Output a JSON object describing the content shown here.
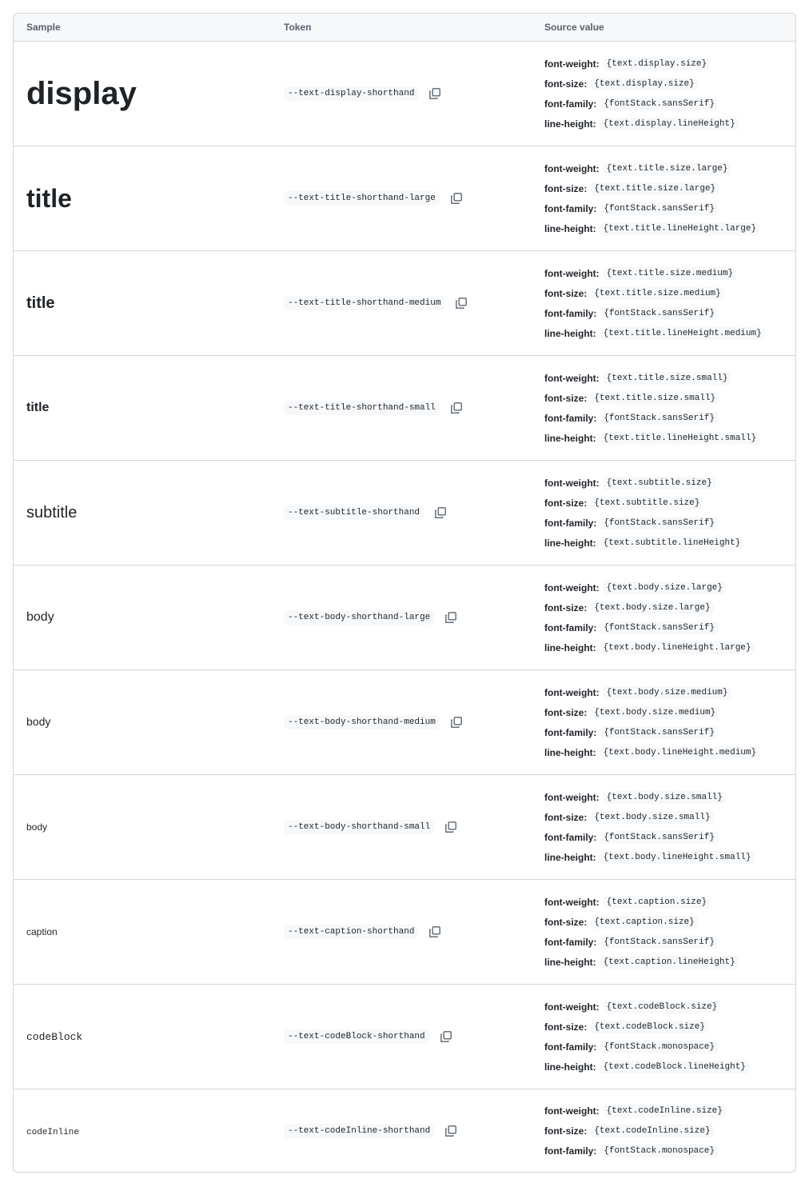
{
  "columns": {
    "sample": "Sample",
    "token": "Token",
    "source": "Source value"
  },
  "labels": {
    "weight": "font-weight:",
    "size": "font-size:",
    "family": "font-family:",
    "lineheight": "line-height:"
  },
  "rows": [
    {
      "sample": "display",
      "token": "--text-display-shorthand",
      "weight": "{text.display.size}",
      "size": "{text.display.size}",
      "family": "{fontStack.sansSerif}",
      "lineheight": "{text.display.lineHeight}"
    },
    {
      "sample": "title",
      "token": "--text-title-shorthand-large",
      "weight": "{text.title.size.large}",
      "size": "{text.title.size.large}",
      "family": "{fontStack.sansSerif}",
      "lineheight": "{text.title.lineHeight.large}"
    },
    {
      "sample": "title",
      "token": "--text-title-shorthand-medium",
      "weight": "{text.title.size.medium}",
      "size": "{text.title.size.medium}",
      "family": "{fontStack.sansSerif}",
      "lineheight": "{text.title.lineHeight.medium}"
    },
    {
      "sample": "title",
      "token": "--text-title-shorthand-small",
      "weight": "{text.title.size.small}",
      "size": "{text.title.size.small}",
      "family": "{fontStack.sansSerif}",
      "lineheight": "{text.title.lineHeight.small}"
    },
    {
      "sample": "subtitle",
      "token": "--text-subtitle-shorthand",
      "weight": "{text.subtitle.size}",
      "size": "{text.subtitle.size}",
      "family": "{fontStack.sansSerif}",
      "lineheight": "{text.subtitle.lineHeight}"
    },
    {
      "sample": "body",
      "token": "--text-body-shorthand-large",
      "weight": "{text.body.size.large}",
      "size": "{text.body.size.large}",
      "family": "{fontStack.sansSerif}",
      "lineheight": "{text.body.lineHeight.large}"
    },
    {
      "sample": "body",
      "token": "--text-body-shorthand-medium",
      "weight": "{text.body.size.medium}",
      "size": "{text.body.size.medium}",
      "family": "{fontStack.sansSerif}",
      "lineheight": "{text.body.lineHeight.medium}"
    },
    {
      "sample": "body",
      "token": "--text-body-shorthand-small",
      "weight": "{text.body.size.small}",
      "size": "{text.body.size.small}",
      "family": "{fontStack.sansSerif}",
      "lineheight": "{text.body.lineHeight.small}"
    },
    {
      "sample": "caption",
      "token": "--text-caption-shorthand",
      "weight": "{text.caption.size}",
      "size": "{text.caption.size}",
      "family": "{fontStack.sansSerif}",
      "lineheight": "{text.caption.lineHeight}"
    },
    {
      "sample": "codeBlock",
      "token": "--text-codeBlock-shorthand",
      "weight": "{text.codeBlock.size}",
      "size": "{text.codeBlock.size}",
      "family": "{fontStack.monospace}",
      "lineheight": "{text.codeBlock.lineHeight}"
    },
    {
      "sample": "codeInline",
      "token": "--text-codeInline-shorthand",
      "weight": "{text.codeInline.size}",
      "size": "{text.codeInline.size}",
      "family": "{fontStack.monospace}"
    }
  ]
}
